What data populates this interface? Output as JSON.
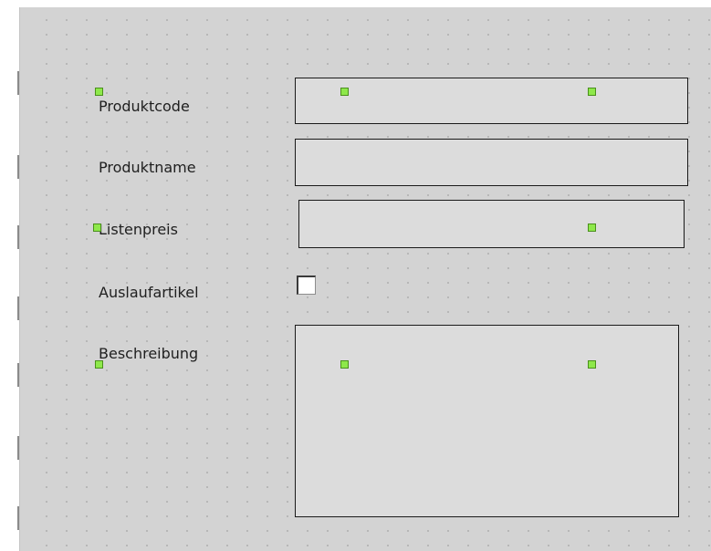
{
  "form": {
    "fields": [
      {
        "label": "Produktcode",
        "type": "textbox"
      },
      {
        "label": "Produktname",
        "type": "textbox"
      },
      {
        "label": "Listenpreis",
        "type": "textbox"
      },
      {
        "label": "Auslaufartikel",
        "type": "checkbox",
        "checked": false
      },
      {
        "label": "Beschreibung",
        "type": "textarea"
      }
    ]
  },
  "colors": {
    "surface": "#d3d3d3",
    "field_background": "#dcdcdc",
    "selection_handle": "#8ee84a"
  },
  "icons": {
    "selection_handle": "green-square-handle-icon"
  }
}
